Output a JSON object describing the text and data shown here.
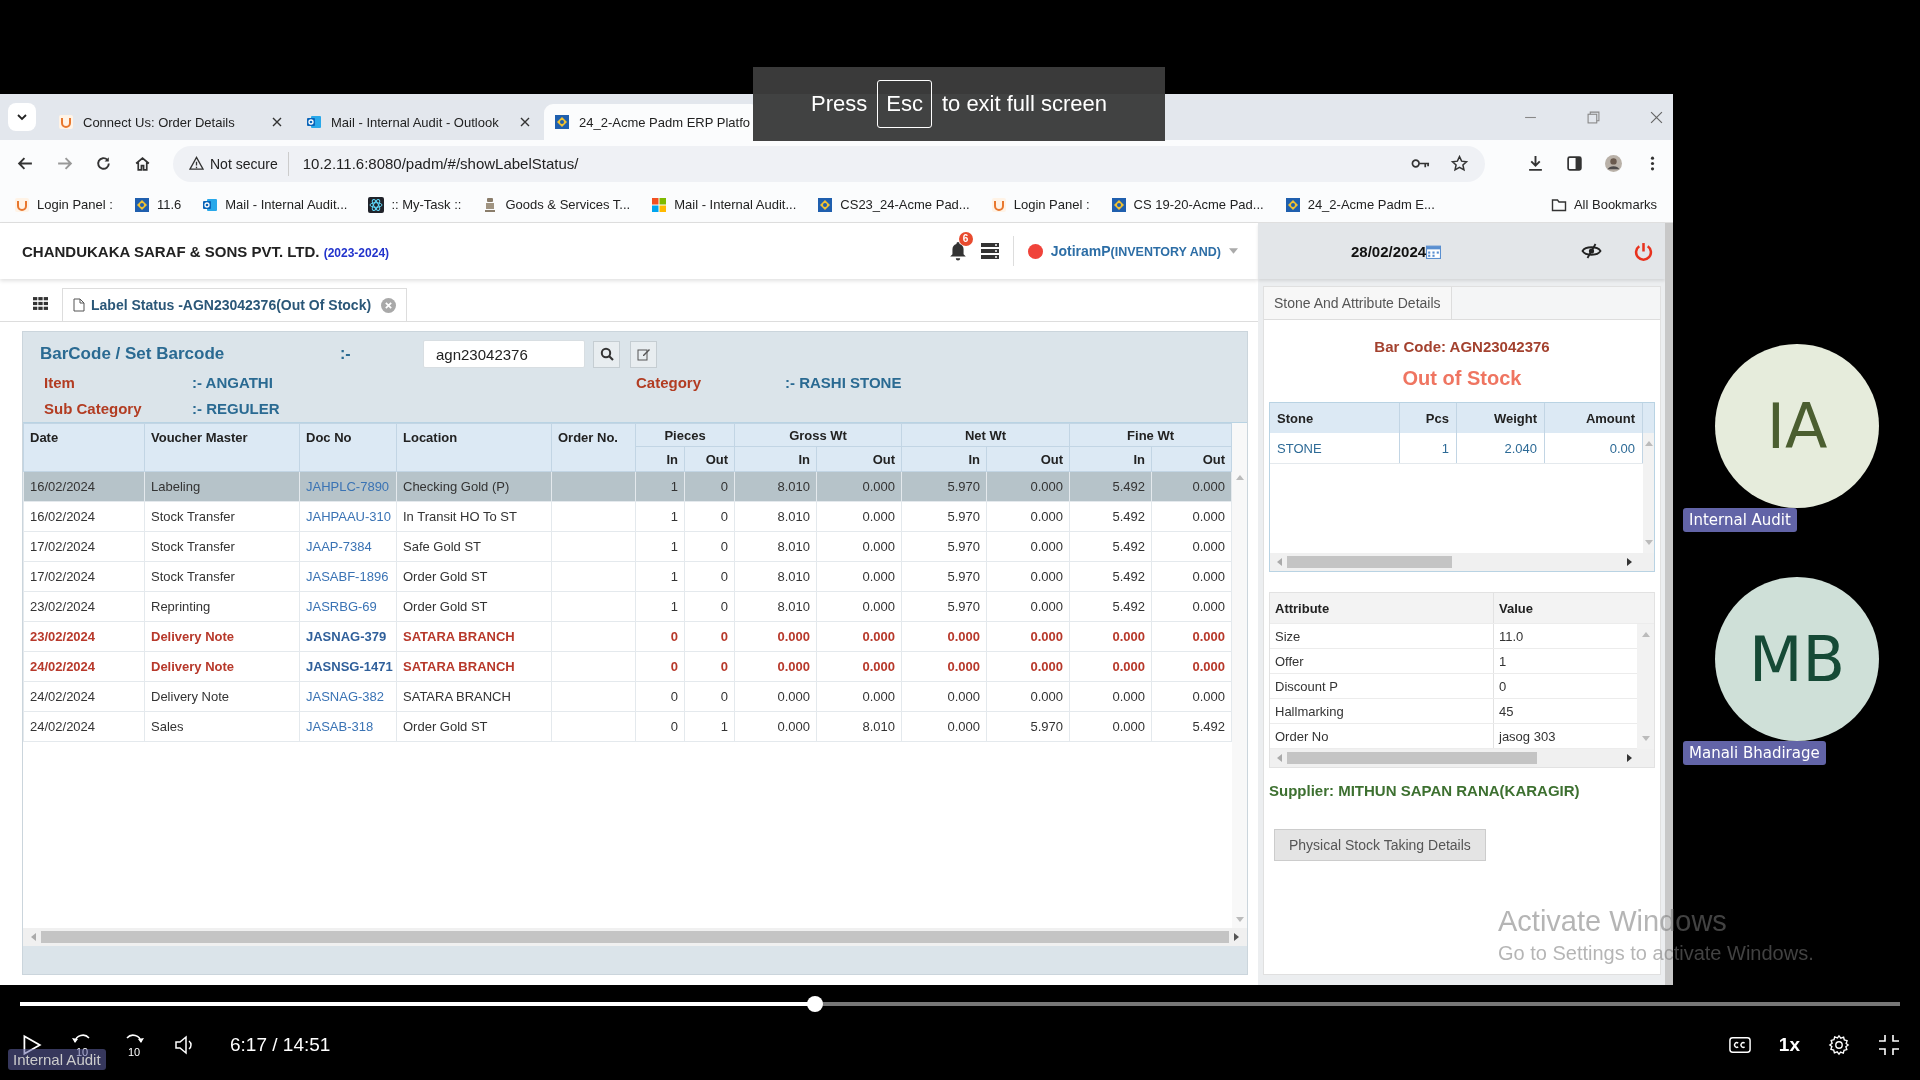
{
  "fullscreen_notice": {
    "before": "Press",
    "key": "Esc",
    "after": "to exit full screen"
  },
  "browser": {
    "tabs": [
      {
        "title": "Connect Us: Order Details",
        "kind": "login",
        "selected": false
      },
      {
        "title": "Mail - Internal Audit - Outlook",
        "kind": "outlook",
        "selected": false
      },
      {
        "title": "24_2-Acme Padm ERP Platfo",
        "kind": "erp",
        "selected": true
      }
    ],
    "security": "Not secure",
    "url": "10.2.11.6:8080/padm/#/showLabelStatus/",
    "bookmarks": [
      {
        "title": "Login Panel :",
        "kind": "login"
      },
      {
        "title": "11.6",
        "kind": "erp"
      },
      {
        "title": "Mail - Internal Audit...",
        "kind": "outlook"
      },
      {
        "title": ":: My-Task ::",
        "kind": "atom"
      },
      {
        "title": "Goods & Services T...",
        "kind": "emblem"
      },
      {
        "title": "Mail - Internal Audit...",
        "kind": "windows"
      },
      {
        "title": "CS23_24-Acme Pad...",
        "kind": "erp"
      },
      {
        "title": "Login Panel :",
        "kind": "login"
      },
      {
        "title": "CS 19-20-Acme Pad...",
        "kind": "erp"
      },
      {
        "title": "24_2-Acme Padm E...",
        "kind": "erp"
      }
    ],
    "all_bookmarks": "All Bookmarks"
  },
  "app": {
    "company": "CHANDUKAKA SARAF & SONS PVT. LTD.",
    "year": "(2023-2024)",
    "notification_count": "6",
    "user": "JotiramP",
    "role": "(INVENTORY AND)",
    "date": "28/02/2024",
    "page_tab": "Label Status -AGN23042376(Out Of Stock)"
  },
  "form": {
    "barcode_label": "BarCode / Set Barcode",
    "barcode_sep": ":-",
    "barcode_value": "agn23042376",
    "fields": [
      {
        "label": "Item",
        "value": ":- ANGATHI"
      },
      {
        "label": "Category",
        "value": ":- RASHI STONE"
      },
      {
        "label": "Sub Category",
        "value": ":- REGULER"
      }
    ]
  },
  "table": {
    "columns": [
      "Date",
      "Voucher Master",
      "Doc No",
      "Location",
      "Order No."
    ],
    "groups": [
      {
        "label": "Pieces",
        "sub": [
          "In",
          "Out"
        ]
      },
      {
        "label": "Gross Wt",
        "sub": [
          "In",
          "Out"
        ]
      },
      {
        "label": "Net Wt",
        "sub": [
          "In",
          "Out"
        ]
      },
      {
        "label": "Fine Wt",
        "sub": [
          "In",
          "Out"
        ]
      }
    ],
    "rows": [
      {
        "kind": "normal",
        "selected": true,
        "cells": [
          "16/02/2024",
          "Labeling",
          "JAHPLC-7890",
          "Checking Gold (P)",
          "",
          "1",
          "0",
          "8.010",
          "0.000",
          "5.970",
          "0.000",
          "5.492",
          "0.000"
        ]
      },
      {
        "kind": "normal",
        "selected": false,
        "cells": [
          "16/02/2024",
          "Stock Transfer",
          "JAHPAAU-310",
          "In Transit HO To ST",
          "",
          "1",
          "0",
          "8.010",
          "0.000",
          "5.970",
          "0.000",
          "5.492",
          "0.000"
        ]
      },
      {
        "kind": "normal",
        "selected": false,
        "cells": [
          "17/02/2024",
          "Stock Transfer",
          "JAAP-7384",
          "Safe Gold ST",
          "",
          "1",
          "0",
          "8.010",
          "0.000",
          "5.970",
          "0.000",
          "5.492",
          "0.000"
        ]
      },
      {
        "kind": "normal",
        "selected": false,
        "cells": [
          "17/02/2024",
          "Stock Transfer",
          "JASABF-1896",
          "Order Gold ST",
          "",
          "1",
          "0",
          "8.010",
          "0.000",
          "5.970",
          "0.000",
          "5.492",
          "0.000"
        ]
      },
      {
        "kind": "normal",
        "selected": false,
        "cells": [
          "23/02/2024",
          "Reprinting",
          "JASRBG-69",
          "Order Gold ST",
          "",
          "1",
          "0",
          "8.010",
          "0.000",
          "5.970",
          "0.000",
          "5.492",
          "0.000"
        ]
      },
      {
        "kind": "alert",
        "selected": false,
        "cells": [
          "23/02/2024",
          "Delivery Note",
          "JASNAG-379",
          "SATARA BRANCH",
          "",
          "0",
          "0",
          "0.000",
          "0.000",
          "0.000",
          "0.000",
          "0.000",
          "0.000"
        ]
      },
      {
        "kind": "alert",
        "selected": false,
        "cells": [
          "24/02/2024",
          "Delivery Note",
          "JASNSG-1471",
          "SATARA BRANCH",
          "",
          "0",
          "0",
          "0.000",
          "0.000",
          "0.000",
          "0.000",
          "0.000",
          "0.000"
        ]
      },
      {
        "kind": "normal",
        "selected": false,
        "cells": [
          "24/02/2024",
          "Delivery Note",
          "JASNAG-382",
          "SATARA BRANCH",
          "",
          "0",
          "0",
          "0.000",
          "0.000",
          "0.000",
          "0.000",
          "0.000",
          "0.000"
        ]
      },
      {
        "kind": "normal",
        "selected": false,
        "cells": [
          "24/02/2024",
          "Sales",
          "JASAB-318",
          "Order Gold ST",
          "",
          "0",
          "1",
          "0.000",
          "8.010",
          "0.000",
          "5.970",
          "0.000",
          "5.492"
        ]
      }
    ]
  },
  "details": {
    "tab": "Stone And Attribute Details",
    "barcode": "Bar Code: AGN23042376",
    "status": "Out of Stock",
    "stone_columns": [
      "Stone",
      "Pcs",
      "Weight",
      "Amount"
    ],
    "stone_rows": [
      [
        "STONE",
        "1",
        "2.040",
        "0.00"
      ]
    ],
    "attribute_columns": [
      "Attribute",
      "Value"
    ],
    "attributes": [
      {
        "name": "Size",
        "value": "11.0"
      },
      {
        "name": "Offer",
        "value": "1"
      },
      {
        "name": "Discount P",
        "value": "0"
      },
      {
        "name": "Hallmarking",
        "value": "45"
      },
      {
        "name": "Order No",
        "value": "jasog 303"
      }
    ],
    "supplier": "Supplier: MITHUN SAPAN RANA(KARAGIR)",
    "button": "Physical Stock Taking Details"
  },
  "os_notice": [
    "Activate Windows",
    "Go to Settings to activate Windows."
  ],
  "participants": [
    {
      "initials": "IA",
      "name": "Internal Audit",
      "color": "#e6ecdc"
    },
    {
      "initials": "MB",
      "name": "Manali Bhadirage",
      "color": "#cfe0d8"
    }
  ],
  "player": {
    "level": 0.423,
    "rewind": "10",
    "forward": "10",
    "time": "6:17 / 14:51",
    "speed": "1x",
    "caption": "Internal Audit"
  }
}
